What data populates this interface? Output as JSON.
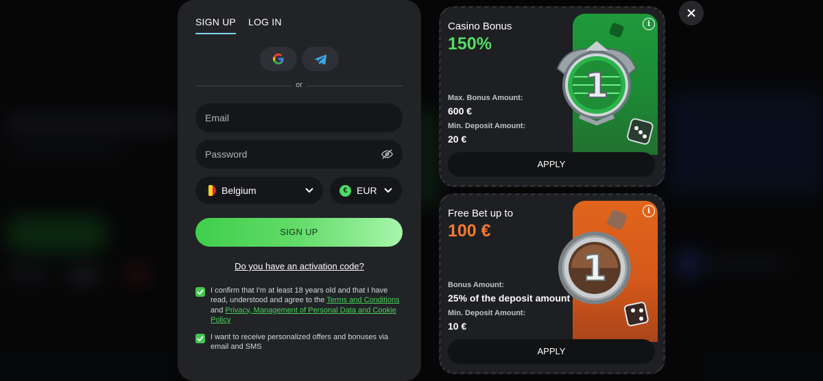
{
  "tabs": [
    {
      "label": "SIGN UP",
      "active": true
    },
    {
      "label": "LOG IN",
      "active": false
    }
  ],
  "social": {
    "google_icon": "google-icon",
    "telegram_icon": "telegram-icon"
  },
  "divider": {
    "or": "or"
  },
  "form": {
    "email_placeholder": "Email",
    "password_placeholder": "Password",
    "country": "Belgium",
    "currency": "EUR",
    "currency_symbol": "€",
    "signup_label": "SIGN UP",
    "activation_link": "Do you have an activation code?"
  },
  "consent": {
    "age_text_1": "I confirm that I'm at least 18 years old and that I have read, understood and agree to the ",
    "terms_link": "Terms and Conditions",
    "and": " and ",
    "privacy_link": "Privacy, Management of Personal Data and Cookie Policy",
    "offers_text": "I want to receive personalized offers and bonuses via email and SMS",
    "age_checked": true,
    "offers_checked": true
  },
  "bonuses": [
    {
      "title": "Casino Bonus",
      "value": "150%",
      "label1": "Max. Bonus Amount:",
      "value1": "600 €",
      "label2": "Min. Deposit Amount:",
      "value2": "20 €",
      "apply": "APPLY",
      "info": "i",
      "accent": "#54dd63",
      "medal_digit": "1"
    },
    {
      "title": "Free Bet up to",
      "value": "100 €",
      "label1": "Bonus Amount:",
      "value1": "25% of the deposit amount",
      "label2": "Min. Deposit Amount:",
      "value2": "10 €",
      "apply": "APPLY",
      "info": "i",
      "accent": "#f57a2b",
      "medal_digit": "1"
    }
  ],
  "close_icon": "close-icon"
}
